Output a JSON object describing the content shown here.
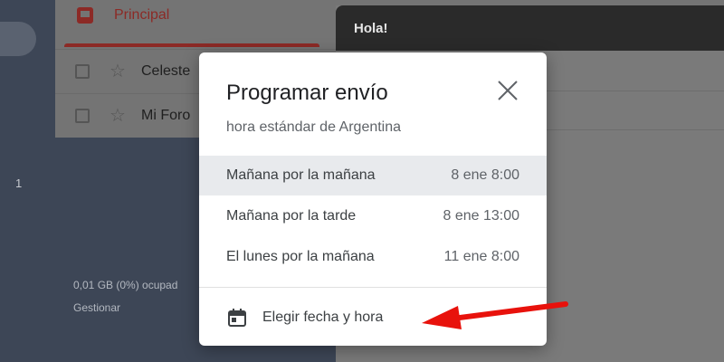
{
  "sidebar": {
    "count": "1"
  },
  "storage": {
    "used": "0,01 GB (0%) ocupad",
    "manage": "Gestionar"
  },
  "list": {
    "tab_label": "Principal",
    "rows": [
      {
        "sender": "Celeste"
      },
      {
        "sender": "Mi Foro"
      }
    ]
  },
  "compose": {
    "title": "Hola!"
  },
  "dialog": {
    "title": "Programar envío",
    "subtitle": "hora estándar de Argentina",
    "options": [
      {
        "label": "Mañana por la mañana",
        "time": "8 ene 8:00"
      },
      {
        "label": "Mañana por la tarde",
        "time": "8 ene 13:00"
      },
      {
        "label": "El lunes por la mañana",
        "time": "11 ene 8:00"
      }
    ],
    "custom_label": "Elegir fecha y hora"
  },
  "colors": {
    "accent": "#d93025",
    "annotation_arrow": "#e8120c",
    "overlay_dark": "#3d4656"
  },
  "icons": {
    "close": "close-icon",
    "calendar": "calendar-icon",
    "inbox": "inbox-icon",
    "star": "star-icon"
  }
}
